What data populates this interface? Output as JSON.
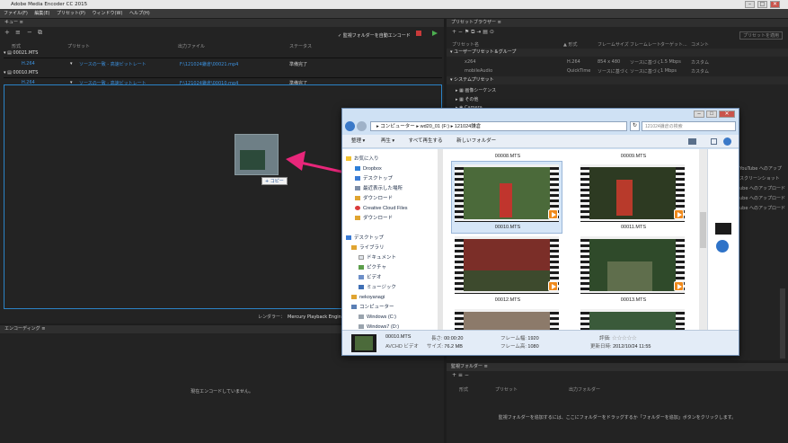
{
  "window": {
    "title": "Adobe Media Encoder CC 2015",
    "min": "–",
    "max": "□",
    "close": "✕"
  },
  "menu": [
    "ファイル(F)",
    "編集(E)",
    "プリセット(P)",
    "ウィンドウ(W)",
    "ヘルプ(H)"
  ],
  "queue": {
    "tab": "キュー  ≡",
    "auto_encode": "✓ 監視フォルダーを自動エンコード",
    "columns": [
      "形式",
      "プリセット",
      "出力ファイル",
      "ステータス"
    ],
    "items": [
      {
        "name": "00021.MTS",
        "format": "H.264",
        "preset": "ソースの一致 - 高速ビットレート",
        "output": "F:\\121024鎌倉\\00021.mp4",
        "status": "準備完了"
      },
      {
        "name": "00010.MTS",
        "format": "H.264",
        "preset": "ソースの一致 - 高速ビットレート",
        "output": "F:\\121024鎌倉\\00010.mp4",
        "status": "準備完了"
      }
    ],
    "renderer_label": "レンダラー：",
    "renderer_value": "Mercury Playback Engine ソ",
    "copy_tooltip": "+ コピー"
  },
  "encoding": {
    "tab": "エンコーディング  ≡",
    "empty": "現在エンコードしていません。"
  },
  "presets": {
    "tab": "プリセットブラウザー  ≡",
    "apply": "プリセットを適用",
    "columns": [
      "プリセット名",
      "形式",
      "フレームサイズ",
      "フレームレート",
      "ターゲット...",
      "コメント"
    ],
    "user_group": "ユーザープリセット＆グループ",
    "user_rows": [
      {
        "name": "x264",
        "format": "H.264",
        "size": "854 x 480",
        "rate": "ソースに基づく",
        "target": "1.5 Mbps",
        "comment": "カスタム"
      },
      {
        "name": "mobileAudio",
        "format": "QuickTime",
        "size": "ソースに基づく",
        "rate": "ソースに基づく",
        "target": "1 Mbps",
        "comment": "カスタム"
      }
    ],
    "system_group": "システムプリセット",
    "system_rows": [
      "画像シーケンス",
      "その他",
      "Camera"
    ],
    "right_snippets": [
      "YouTube へのアップ",
      "スクリーンショット",
      "ube へのアップロード",
      "ube へのアップロード",
      "ube へのアップロード"
    ]
  },
  "watch": {
    "tab": "監視フォルダー  ≡",
    "columns": [
      "形式",
      "プリセット",
      "出力フォルダー"
    ],
    "empty": "監視フォルダーを追加するには、ここにフォルダーをドラッグするか「フォルダーを追加」ボタンをクリックします。"
  },
  "explorer": {
    "breadcrumb": [
      "コンピューター",
      "wd20_01 (F:)",
      "121024鎌倉"
    ],
    "search": "121024鎌倉の検索",
    "toolbar": [
      "整理 ▾",
      "再生 ▾",
      "すべて再生する",
      "新しいフォルダー"
    ],
    "nav": [
      {
        "label": "お気に入り",
        "icon": "star-icon",
        "color": "#f2c230"
      },
      {
        "label": "Dropbox",
        "icon": "dropbox-icon",
        "color": "#2d7fd8"
      },
      {
        "label": "デスクトップ",
        "icon": "desktop-icon",
        "color": "#3a7bd5"
      },
      {
        "label": "最近表示した場所",
        "icon": "recent-icon",
        "color": "#7d8da6"
      },
      {
        "label": "ダウンロード",
        "icon": "download-icon",
        "color": "#e0a431"
      },
      {
        "label": "Creative Cloud Files",
        "icon": "cc-icon",
        "color": "#da3b3b"
      },
      {
        "label": "ダウンロード",
        "icon": "download-icon",
        "color": "#e0a431"
      },
      {
        "label": "",
        "icon": "",
        "color": ""
      },
      {
        "label": "デスクトップ",
        "icon": "desktop-icon",
        "color": "#3a7bd5"
      },
      {
        "label": "ライブラリ",
        "icon": "library-icon",
        "color": "#e0a431"
      },
      {
        "label": "ドキュメント",
        "icon": "document-icon",
        "color": "#f2f2f2"
      },
      {
        "label": "ピクチャ",
        "icon": "pictures-icon",
        "color": "#5c9e4b"
      },
      {
        "label": "ビデオ",
        "icon": "video-icon",
        "color": "#6d8fc8"
      },
      {
        "label": "ミュージック",
        "icon": "music-icon",
        "color": "#3f6fb5"
      },
      {
        "label": "nekoyanagi",
        "icon": "user-icon",
        "color": "#e0a431"
      },
      {
        "label": "コンピューター",
        "icon": "computer-icon",
        "color": "#5a7fb5"
      },
      {
        "label": "Windows (C:)",
        "icon": "drive-icon",
        "color": "#9aa4ae"
      },
      {
        "label": "Windows7 (D:)",
        "icon": "drive-icon",
        "color": "#9aa4ae"
      }
    ],
    "files": [
      "00008.MTS",
      "00009.MTS",
      "00010.MTS",
      "00011.MTS",
      "00012.MTS",
      "00013.MTS"
    ],
    "details": {
      "name": "00010.MTS",
      "type": "AVCHD ビデオ",
      "length_label": "長さ:",
      "length": "00:00:20",
      "size_label": "サイズ:",
      "size": "76.2 MB",
      "width_label": "フレーム幅:",
      "width": "1920",
      "height_label": "フレーム高:",
      "height": "1080",
      "rating_label": "評価:",
      "rating": "☆☆☆☆☆",
      "date_label": "更新日時:",
      "date": "2012/10/24 11:55"
    }
  }
}
